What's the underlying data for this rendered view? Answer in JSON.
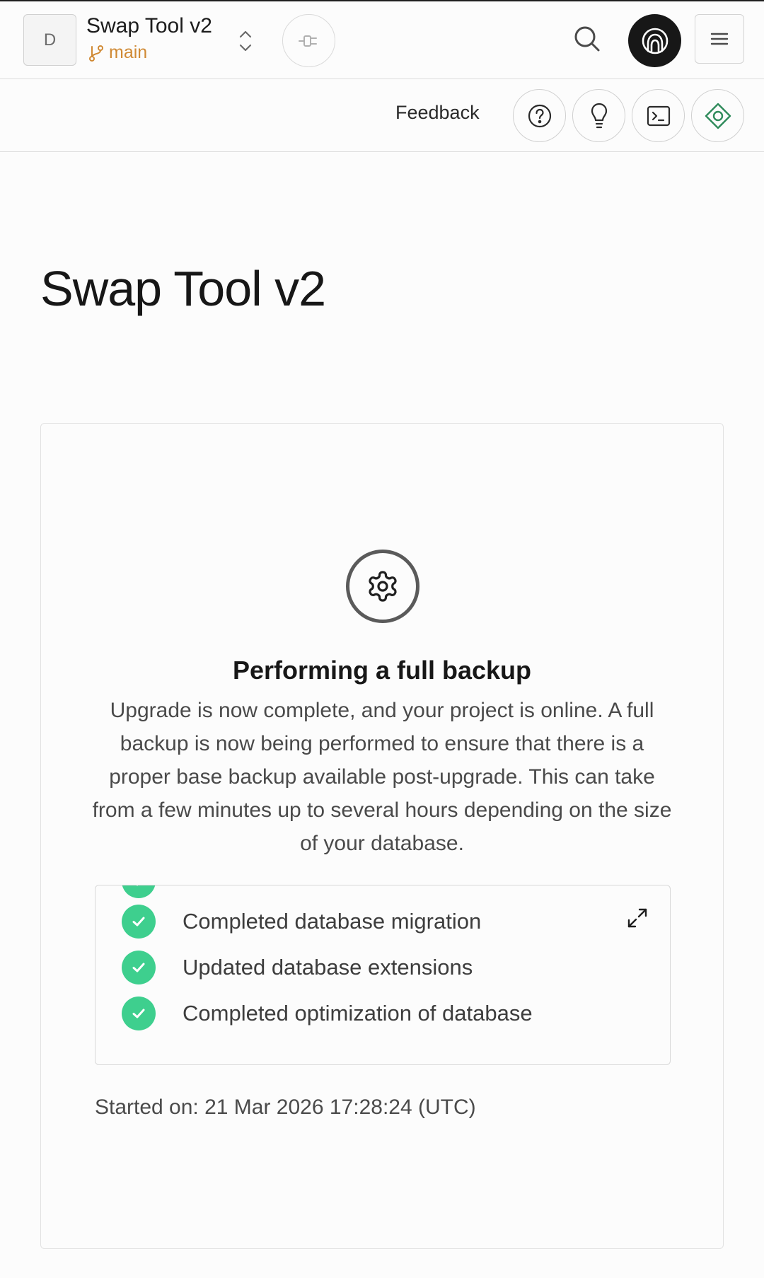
{
  "topbar": {
    "org_initial": "D",
    "project_name": "Swap Tool v2",
    "branch_name": "main"
  },
  "subbar": {
    "feedback_label": "Feedback"
  },
  "page": {
    "title": "Swap Tool v2"
  },
  "backup": {
    "title": "Performing a full backup",
    "description": "Upgrade is now complete, and your project is online. A full backup is now being performed to ensure that there is a proper base backup available post-upgrade. This can take from a few minutes up to several hours depending on the size of your database.",
    "steps": [
      "Completed database migration",
      "Updated database extensions",
      "Completed optimization of database"
    ],
    "started_on": "Started on: 21 Mar 2026 17:28:24 (UTC)"
  },
  "colors": {
    "accent": "#3ecf8e",
    "branch": "#d08a35",
    "dark": "#171717"
  },
  "icons": {
    "connect": "plug-icon",
    "search": "search-icon",
    "account": "account-icon",
    "menu": "menu-icon",
    "help": "help-icon",
    "tips": "lightbulb-icon",
    "terminal": "terminal-icon",
    "assistant": "diamond-icon",
    "status": "gear-icon",
    "check": "check-icon",
    "expand": "expand-icon"
  }
}
